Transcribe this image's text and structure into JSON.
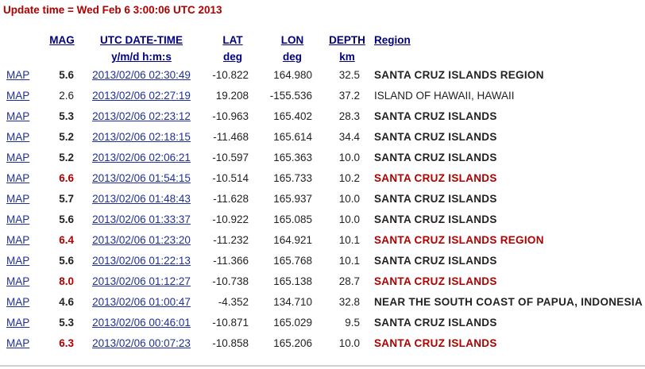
{
  "update": {
    "text": "Update time = Wed Feb 6 3:00:06 UTC 2013"
  },
  "headers": {
    "mag": "MAG",
    "date_line1": "UTC DATE-TIME",
    "date_line2": "y/m/d h:m:s",
    "lat_line1": "LAT",
    "lat_line2": "deg",
    "lon_line1": "LON",
    "lon_line2": "deg",
    "depth_line1": "DEPTH",
    "depth_line2": "km",
    "region": "Region"
  },
  "colors": {
    "highlight": "#b00000",
    "link": "#1e2f9c",
    "header": "#000080"
  },
  "rows": [
    {
      "map": "MAP",
      "mag": "5.6",
      "mag_style": "bold",
      "datetime": "2013/02/06 02:30:49",
      "lat": "-10.822",
      "lon": "164.980",
      "depth": "32.5",
      "region": "SANTA CRUZ ISLANDS REGION"
    },
    {
      "map": "MAP",
      "mag": "2.6",
      "mag_style": "normal",
      "datetime": "2013/02/06 02:27:19",
      "lat": "19.208",
      "lon": "-155.536",
      "depth": "37.2",
      "region": "ISLAND OF HAWAII, HAWAII"
    },
    {
      "map": "MAP",
      "mag": "5.3",
      "mag_style": "bold",
      "datetime": "2013/02/06 02:23:12",
      "lat": "-10.963",
      "lon": "165.402",
      "depth": "28.3",
      "region": "SANTA CRUZ ISLANDS"
    },
    {
      "map": "MAP",
      "mag": "5.2",
      "mag_style": "bold",
      "datetime": "2013/02/06 02:18:15",
      "lat": "-11.468",
      "lon": "165.614",
      "depth": "34.4",
      "region": "SANTA CRUZ ISLANDS"
    },
    {
      "map": "MAP",
      "mag": "5.2",
      "mag_style": "bold",
      "datetime": "2013/02/06 02:06:21",
      "lat": "-10.597",
      "lon": "165.363",
      "depth": "10.0",
      "region": "SANTA CRUZ ISLANDS"
    },
    {
      "map": "MAP",
      "mag": "6.6",
      "mag_style": "red",
      "datetime": "2013/02/06 01:54:15",
      "lat": "-10.514",
      "lon": "165.733",
      "depth": "10.2",
      "region": "SANTA CRUZ ISLANDS"
    },
    {
      "map": "MAP",
      "mag": "5.7",
      "mag_style": "bold",
      "datetime": "2013/02/06 01:48:43",
      "lat": "-11.628",
      "lon": "165.937",
      "depth": "10.0",
      "region": "SANTA CRUZ ISLANDS"
    },
    {
      "map": "MAP",
      "mag": "5.6",
      "mag_style": "bold",
      "datetime": "2013/02/06 01:33:37",
      "lat": "-10.922",
      "lon": "165.085",
      "depth": "10.0",
      "region": "SANTA CRUZ ISLANDS"
    },
    {
      "map": "MAP",
      "mag": "6.4",
      "mag_style": "red",
      "datetime": "2013/02/06 01:23:20",
      "lat": "-11.232",
      "lon": "164.921",
      "depth": "10.1",
      "region": "SANTA CRUZ ISLANDS REGION"
    },
    {
      "map": "MAP",
      "mag": "5.6",
      "mag_style": "bold",
      "datetime": "2013/02/06 01:22:13",
      "lat": "-11.366",
      "lon": "165.768",
      "depth": "10.1",
      "region": "SANTA CRUZ ISLANDS"
    },
    {
      "map": "MAP",
      "mag": "8.0",
      "mag_style": "red",
      "datetime": "2013/02/06 01:12:27",
      "lat": "-10.738",
      "lon": "165.138",
      "depth": "28.7",
      "region": "SANTA CRUZ ISLANDS"
    },
    {
      "map": "MAP",
      "mag": "4.6",
      "mag_style": "bold",
      "datetime": "2013/02/06 01:00:47",
      "lat": "-4.352",
      "lon": "134.710",
      "depth": "32.8",
      "region": "NEAR THE SOUTH COAST OF PAPUA, INDONESIA"
    },
    {
      "map": "MAP",
      "mag": "5.3",
      "mag_style": "bold",
      "datetime": "2013/02/06 00:46:01",
      "lat": "-10.871",
      "lon": "165.029",
      "depth": "9.5",
      "region": "SANTA CRUZ ISLANDS"
    },
    {
      "map": "MAP",
      "mag": "6.3",
      "mag_style": "red",
      "datetime": "2013/02/06 00:07:23",
      "lat": "-10.858",
      "lon": "165.206",
      "depth": "10.0",
      "region": "SANTA CRUZ ISLANDS"
    }
  ]
}
